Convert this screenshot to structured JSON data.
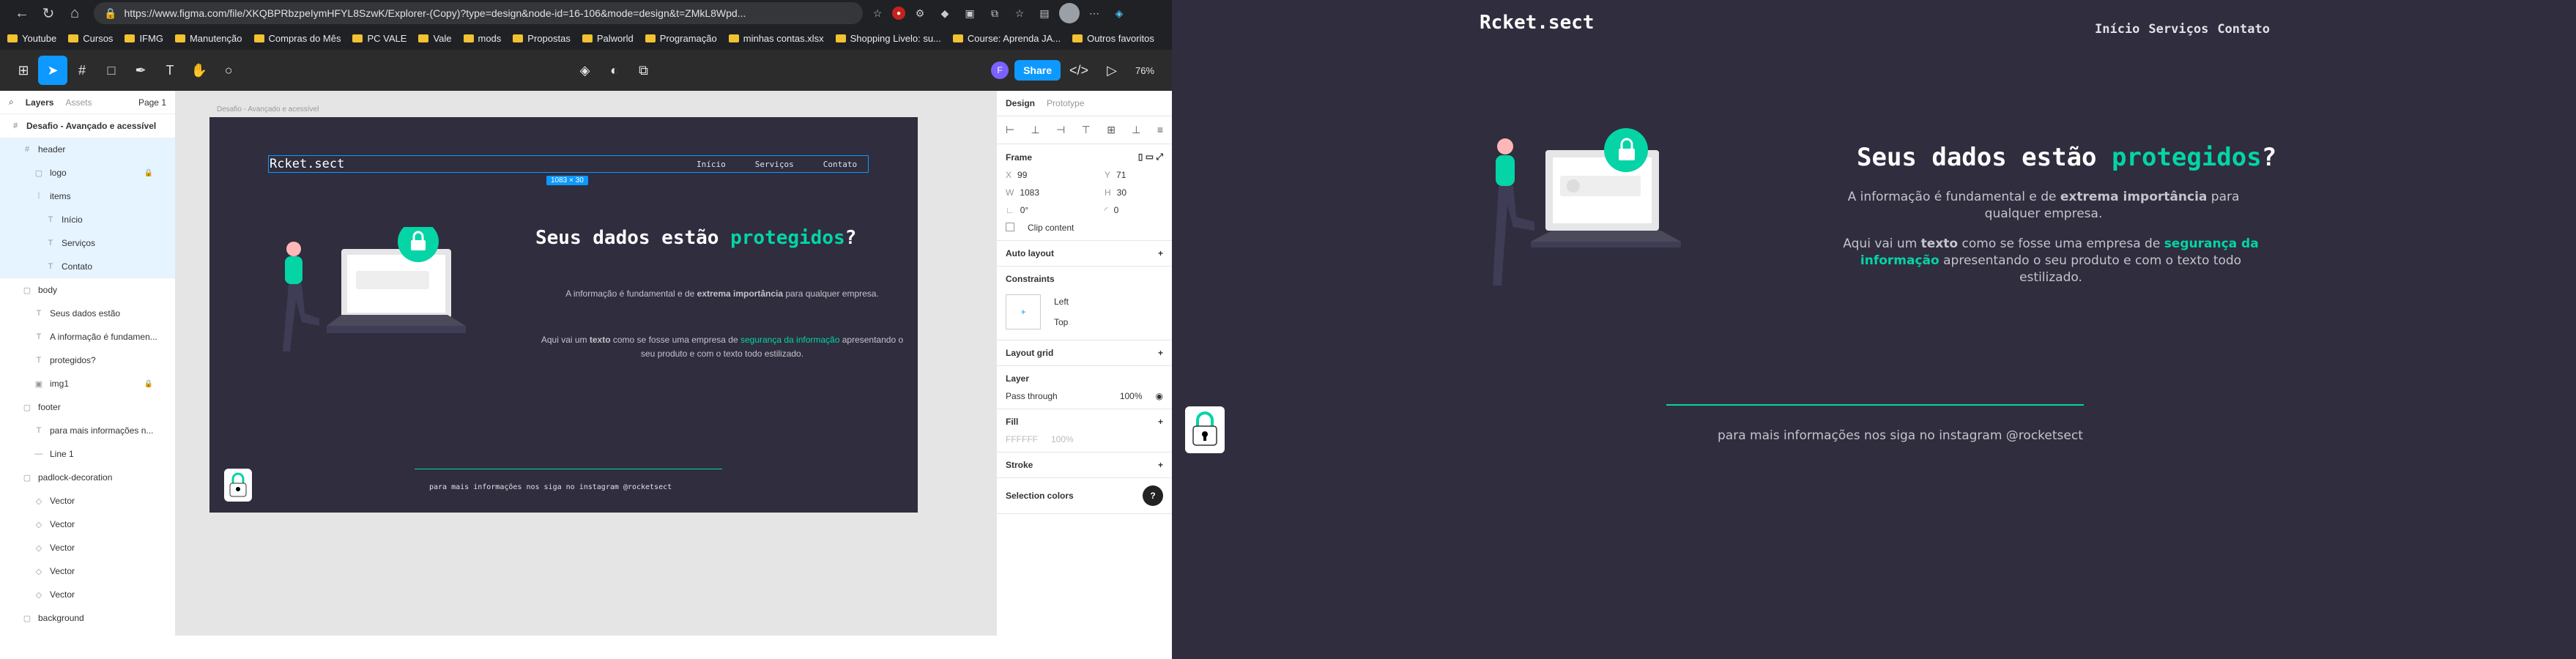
{
  "browser": {
    "url": "https://www.figma.com/file/XKQBPRbzpeIymHFYL8SzwK/Explorer-(Copy)?type=design&node-id=16-106&mode=design&t=ZMkL8Wpd...",
    "bookmarks": [
      "Youtube",
      "Cursos",
      "IFMG",
      "Manutenção",
      "Compras do Mês",
      "PC VALE",
      "Vale",
      "mods",
      "Propostas",
      "Palworld",
      "Programação",
      "minhas contas.xlsx",
      "Shopping Livelo: su...",
      "Course: Aprenda JA...",
      "Outros favoritos"
    ]
  },
  "figma": {
    "share_label": "Share",
    "zoom": "76%",
    "avatar_letter": "F",
    "left_tabs": {
      "layers": "Layers",
      "assets": "Assets",
      "page": "Page 1"
    },
    "project_name": "Desafio - Avançado e acessível",
    "frame_label": "Desafio - Avançado e acessível",
    "dim_badge": "1083 × 30",
    "layers": [
      {
        "name": "header",
        "indent": 1,
        "icon": "#",
        "selected": true
      },
      {
        "name": "logo",
        "indent": 2,
        "icon": "▢",
        "selected": true,
        "locked": true
      },
      {
        "name": "items",
        "indent": 2,
        "icon": "⁞",
        "selected": true
      },
      {
        "name": "Início",
        "indent": 3,
        "icon": "T",
        "selected": true
      },
      {
        "name": "Serviços",
        "indent": 3,
        "icon": "T",
        "selected": true
      },
      {
        "name": "Contato",
        "indent": 3,
        "icon": "T",
        "selected": true
      },
      {
        "name": "body",
        "indent": 1,
        "icon": "▢",
        "selected": false
      },
      {
        "name": "Seus dados estão",
        "indent": 2,
        "icon": "T",
        "selected": false
      },
      {
        "name": "A informação é fundamen...",
        "indent": 2,
        "icon": "T",
        "selected": false
      },
      {
        "name": "protegidos?",
        "indent": 2,
        "icon": "T",
        "selected": false
      },
      {
        "name": "img1",
        "indent": 2,
        "icon": "▣",
        "selected": false,
        "locked": true
      },
      {
        "name": "footer",
        "indent": 1,
        "icon": "▢",
        "selected": false
      },
      {
        "name": "para mais informações n...",
        "indent": 2,
        "icon": "T",
        "selected": false
      },
      {
        "name": "Line 1",
        "indent": 2,
        "icon": "—",
        "selected": false
      },
      {
        "name": "padlock-decoration",
        "indent": 1,
        "icon": "▢",
        "selected": false
      },
      {
        "name": "Vector",
        "indent": 2,
        "icon": "◇",
        "selected": false
      },
      {
        "name": "Vector",
        "indent": 2,
        "icon": "◇",
        "selected": false
      },
      {
        "name": "Vector",
        "indent": 2,
        "icon": "◇",
        "selected": false
      },
      {
        "name": "Vector",
        "indent": 2,
        "icon": "◇",
        "selected": false
      },
      {
        "name": "Vector",
        "indent": 2,
        "icon": "◇",
        "selected": false
      },
      {
        "name": "background",
        "indent": 1,
        "icon": "▢",
        "selected": false
      }
    ],
    "right": {
      "tab_design": "Design",
      "tab_prototype": "Prototype",
      "frame_label": "Frame",
      "x": "99",
      "y": "71",
      "w": "1083",
      "h": "30",
      "rotation": "0°",
      "radius": "0",
      "clip": "Clip content",
      "auto_layout": "Auto layout",
      "constraints": "Constraints",
      "c_left": "Left",
      "c_top": "Top",
      "layout_grid": "Layout grid",
      "layer": "Layer",
      "pass": "Pass through",
      "opacity": "100%",
      "fill": "Fill",
      "fill_hex": "FFFFFF",
      "fill_op": "100%",
      "stroke": "Stroke",
      "selection_colors": "Selection colors"
    }
  },
  "site": {
    "logo_a": "R",
    "logo_b": "cket.sect",
    "nav": [
      "Início",
      "Serviços",
      "Contato"
    ],
    "title_a": "Seus dados estão ",
    "title_b": "protegidos",
    "title_c": "?",
    "p1_a": "A informação é fundamental e de ",
    "p1_b": "extrema importância",
    "p1_c": " para qualquer empresa.",
    "p2_a": "Aqui vai um ",
    "p2_b": "texto",
    "p2_c": " como se fosse uma empresa de ",
    "p2_d": "segurança da informação",
    "p2_e": " apresentando o seu produto e com o texto todo estilizado.",
    "footer": "para mais informações nos siga no instagram @rocketsect"
  },
  "colors": {
    "bg": "#2f2d3e",
    "accent": "#04d4a6",
    "figma_blue": "#0d99ff"
  }
}
